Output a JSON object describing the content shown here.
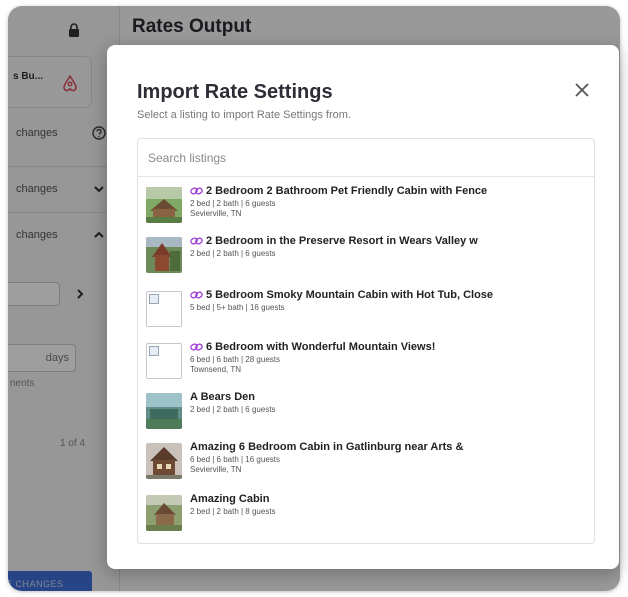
{
  "background": {
    "page_title": "Rates Output",
    "listing_short": "s Bu...",
    "sidebar_rows": [
      {
        "label": "changes"
      },
      {
        "label": "changes"
      },
      {
        "label": "changes"
      }
    ],
    "days_label": "days",
    "ments_label": "nents",
    "pager": "1 of 4",
    "save_label": "E CHANGES"
  },
  "modal": {
    "title": "Import Rate Settings",
    "subtitle": "Select a listing to import Rate Settings from.",
    "search_placeholder": "Search listings",
    "close_icon": "close-icon",
    "link_color": "#9b39d6"
  },
  "listings": [
    {
      "title": "2 Bedroom 2 Bathroom Pet Friendly Cabin with Fence",
      "specs": "2 bed | 2 bath | 6 guests",
      "location": "Sevierville, TN",
      "linked": true,
      "thumb": "cabin-photo"
    },
    {
      "title": "2 Bedroom in the Preserve Resort in Wears Valley w",
      "specs": "2 bed | 2 bath | 6 guests",
      "location": "",
      "linked": true,
      "thumb": "cabin-photo"
    },
    {
      "title": "5 Bedroom Smoky Mountain Cabin with Hot Tub, Close",
      "specs": "5 bed | 5+ bath | 16 guests",
      "location": "",
      "linked": true,
      "thumb": "broken-image"
    },
    {
      "title": "6 Bedroom with Wonderful Mountain Views!",
      "specs": "6 bed | 6 bath | 28 guests",
      "location": "Townsend, TN",
      "linked": true,
      "thumb": "broken-image"
    },
    {
      "title": "A Bears Den",
      "specs": "2 bed | 2 bath | 6 guests",
      "location": "",
      "linked": false,
      "thumb": "cabin-photo"
    },
    {
      "title": "Amazing 6 Bedroom Cabin in Gatlinburg near Arts &",
      "specs": "6 bed | 6 bath | 16 guests",
      "location": "Sevierville, TN",
      "linked": false,
      "thumb": "cabin-photo"
    },
    {
      "title": "Amazing Cabin",
      "specs": "2 bed | 2 bath | 8 guests",
      "location": "",
      "linked": false,
      "thumb": "cabin-photo"
    }
  ]
}
